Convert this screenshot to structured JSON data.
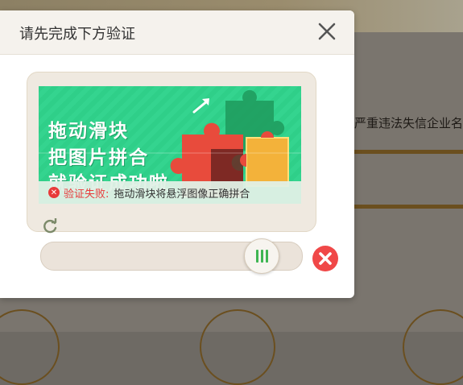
{
  "dialog": {
    "title": "请先完成下方验证",
    "close_icon": "close-icon"
  },
  "captcha": {
    "slogan_lines": [
      "拖动滑块",
      "把图片拼合",
      "就验证成功啦"
    ],
    "status_label": "验证失败:",
    "status_message": "拖动滑块将悬浮图像正确拼合",
    "refresh_icon": "refresh-icon",
    "slider_icon": "grip-icon",
    "fail_icon": "error-circle-icon",
    "slider_progress": 0.82
  },
  "background": {
    "text": "严重违法失信企业名"
  },
  "colors": {
    "accent_green": "#2fcf89",
    "error_red": "#e83a3a",
    "grip_green": "#3eb552"
  }
}
